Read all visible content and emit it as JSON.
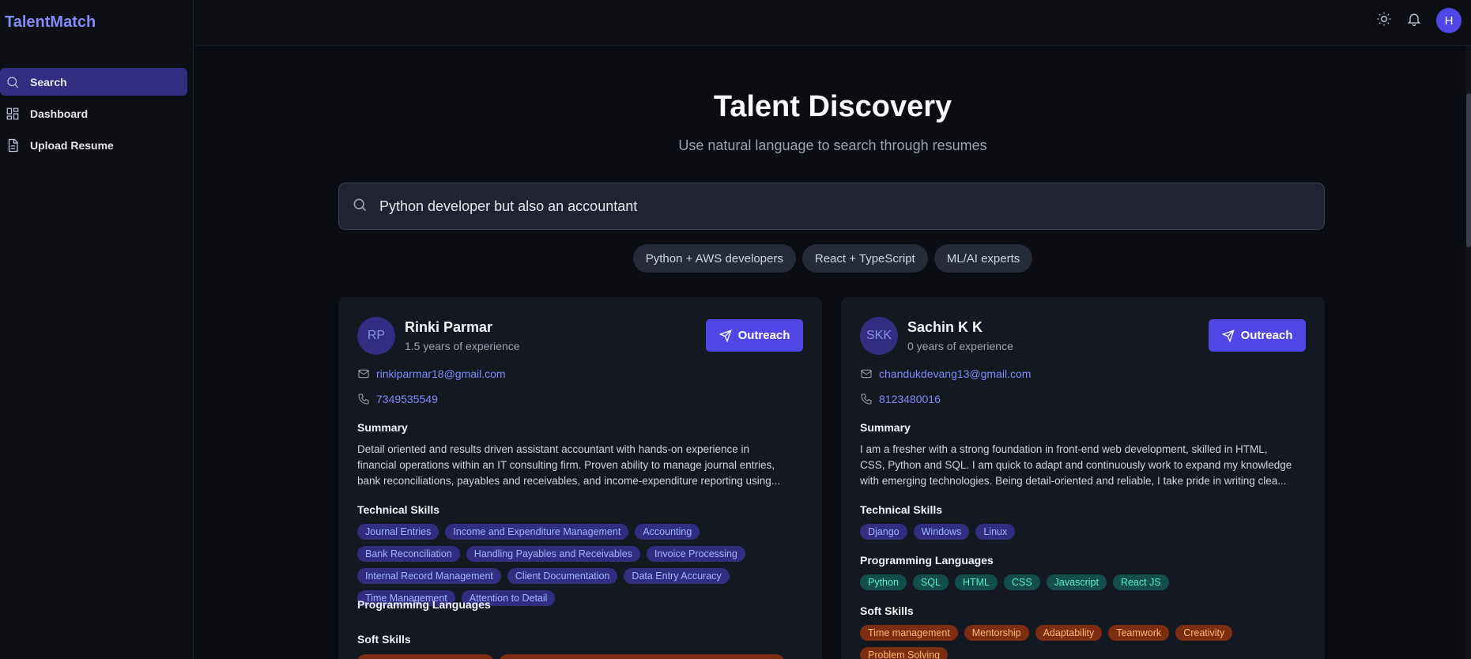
{
  "app": {
    "brand": "TalentMatch"
  },
  "sidebar": {
    "items": [
      {
        "label": "Search",
        "icon": "search-icon",
        "active": true
      },
      {
        "label": "Dashboard",
        "icon": "dashboard-icon",
        "active": false
      },
      {
        "label": "Upload Resume",
        "icon": "document-icon",
        "active": false
      }
    ]
  },
  "topbar": {
    "avatar_initial": "H",
    "icons": [
      "sun-icon",
      "bell-icon"
    ]
  },
  "hero": {
    "title": "Talent Discovery",
    "subtitle": "Use natural language to search through resumes"
  },
  "search": {
    "value": "Python developer but also an accountant",
    "placeholder": ""
  },
  "suggestions": [
    "Python + AWS developers",
    "React + TypeScript",
    "ML/AI experts"
  ],
  "colors": {
    "accent": "#4f46e5",
    "brand": "#818cf8",
    "background": "#0b0d12",
    "card": "#141821"
  },
  "candidates": [
    {
      "initials": "RP",
      "name": "Rinki Parmar",
      "experience": "1.5 years of experience",
      "outreach_label": "Outreach",
      "email": "rinkiparmar18@gmail.com",
      "phone": "7349535549",
      "summary_heading": "Summary",
      "summary_lines": [
        "Detail oriented and results driven assistant accountant with hands-on experience in",
        "financial operations within an IT consulting firm. Proven ability to manage journal entries,",
        "bank reconciliations, payables and receivables, and income-expenditure reporting using..."
      ],
      "technical_heading": "Technical Skills",
      "technical_skills": [
        "Journal Entries",
        "Income and Expenditure Management",
        "Accounting",
        "Bank Reconciliation",
        "Handling Payables and Receivables",
        "Invoice Processing",
        "Internal Record Management",
        "Client Documentation",
        "Data Entry Accuracy",
        "Time Management",
        "Attention to Detail"
      ],
      "programming_heading": "Programming Languages",
      "programming_languages": [],
      "soft_heading": "Soft Skills",
      "soft_skills": []
    },
    {
      "initials": "SKK",
      "name": "Sachin K K",
      "experience": "0 years of experience",
      "outreach_label": "Outreach",
      "email": "chandukdevang13@gmail.com",
      "phone": "8123480016",
      "summary_heading": "Summary",
      "summary_lines": [
        "I am a fresher with a strong foundation in front-end web development, skilled in HTML,",
        "CSS, Python and SQL. I am quick to adapt and continuously work to expand my knowledge",
        "with emerging technologies. Being detail-oriented and reliable, I take pride in writing clea..."
      ],
      "technical_heading": "Technical Skills",
      "technical_skills": [
        "Django",
        "Windows",
        "Linux"
      ],
      "programming_heading": "Programming Languages",
      "programming_languages": [
        "Python",
        "SQL",
        "HTML",
        "CSS",
        "Javascript",
        "React JS"
      ],
      "soft_heading": "Soft Skills",
      "soft_skills": [
        "Time management",
        "Mentorship",
        "Adaptability",
        "Teamwork",
        "Creativity",
        "Problem Solving"
      ]
    }
  ]
}
